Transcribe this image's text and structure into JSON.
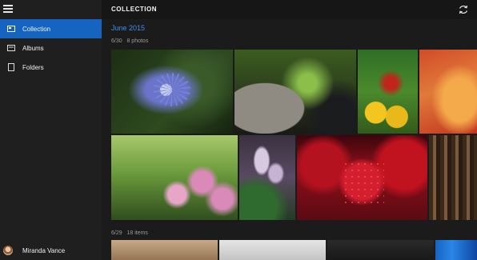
{
  "header": {
    "title": "COLLECTION",
    "sync_icon": "sync-icon"
  },
  "sidebar": {
    "menu_icon": "hamburger-icon",
    "items": [
      {
        "label": "Collection",
        "icon": "collection-icon",
        "active": true
      },
      {
        "label": "Albums",
        "icon": "albums-icon",
        "active": false
      },
      {
        "label": "Folders",
        "icon": "folder-icon",
        "active": false
      }
    ],
    "user": {
      "name": "Miranda Vance"
    }
  },
  "content": {
    "month": "June 2015",
    "groups": [
      {
        "date": "6/30",
        "count": "8 photos"
      },
      {
        "date": "6/29",
        "count": "18 items"
      }
    ]
  },
  "colors": {
    "accent": "#1565c0",
    "month_text": "#3b8fe6",
    "background": "#1b1b1b"
  }
}
